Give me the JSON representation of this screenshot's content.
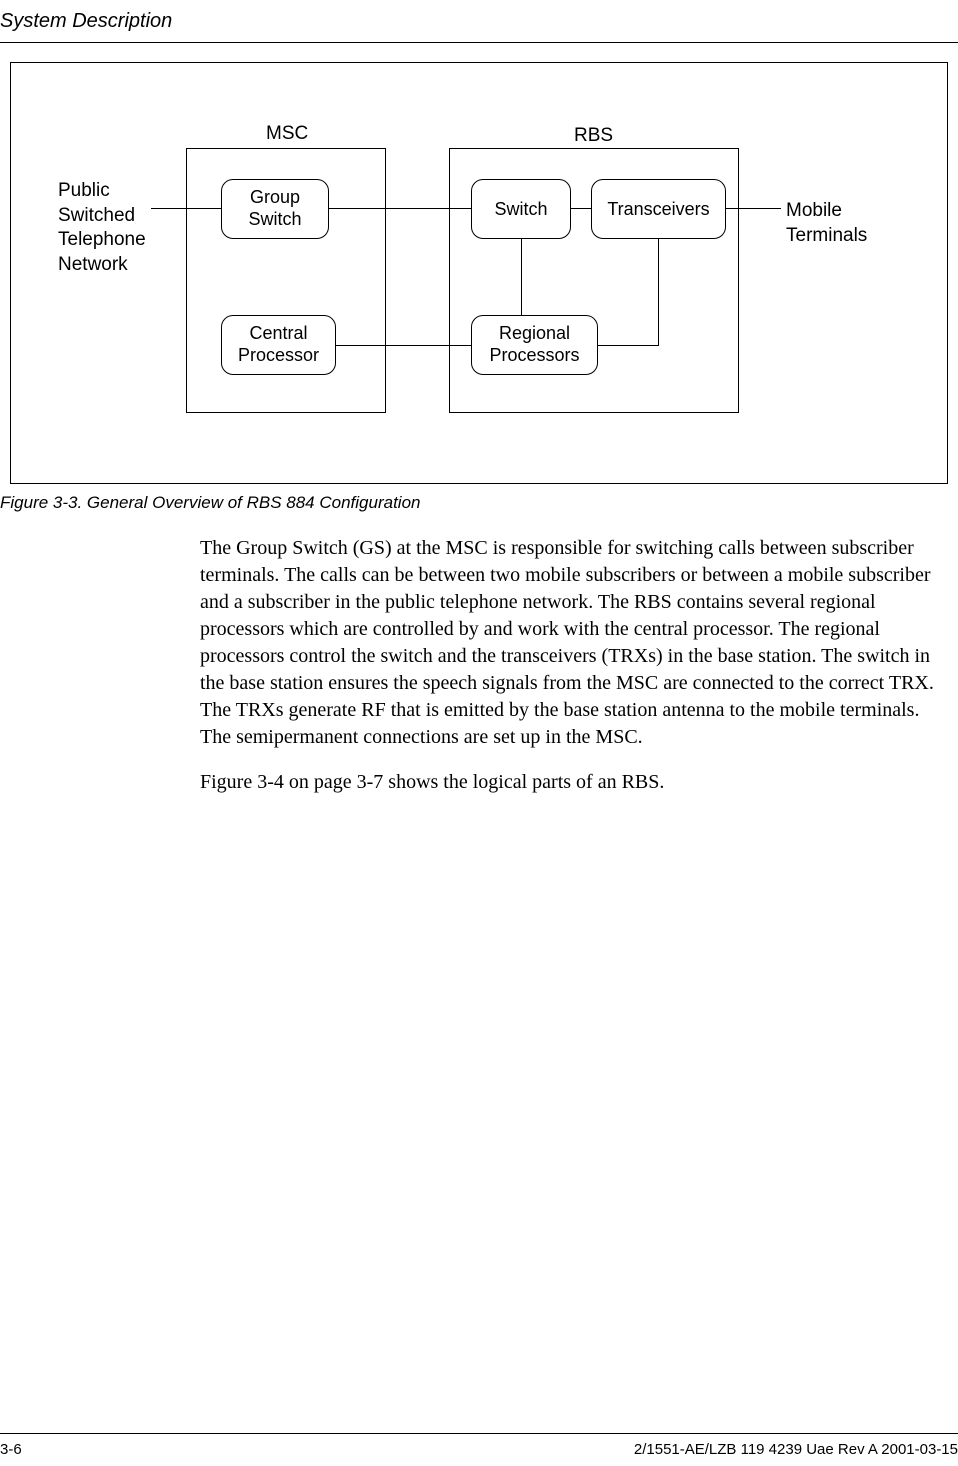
{
  "header": {
    "title": "System Description"
  },
  "figure": {
    "msc_label": "MSC",
    "rbs_label": "RBS",
    "pstn": "Public\nSwitched\nTelephone\nNetwork",
    "mobile": "Mobile\nTerminals",
    "group_switch": "Group\nSwitch",
    "central_processor": "Central\nProcessor",
    "switch": "Switch",
    "transceivers": "Transceivers",
    "regional_processors": "Regional\nProcessors"
  },
  "caption": "Figure 3-3.    General Overview of RBS 884 Configuration",
  "body": {
    "p1": "The Group Switch (GS) at the MSC is responsible for switching calls between subscriber terminals. The calls can be between two mobile subscribers or between a mobile subscriber and a subscriber in the public telephone network. The RBS contains several regional processors which are controlled by and work with the central processor. The regional processors control the switch and the transceivers (TRXs) in the base station. The switch in the base station ensures the speech signals from the MSC are connected to the correct TRX. The TRXs generate RF that is emitted by the base station antenna to the mobile terminals. The semipermanent connections are set up in the MSC.",
    "p2": "Figure 3-4 on page 3-7 shows the logical parts of an RBS."
  },
  "footer": {
    "page": "3-6",
    "docid": "2/1551-AE/LZB 119 4239 Uae Rev A 2001-03-15"
  }
}
